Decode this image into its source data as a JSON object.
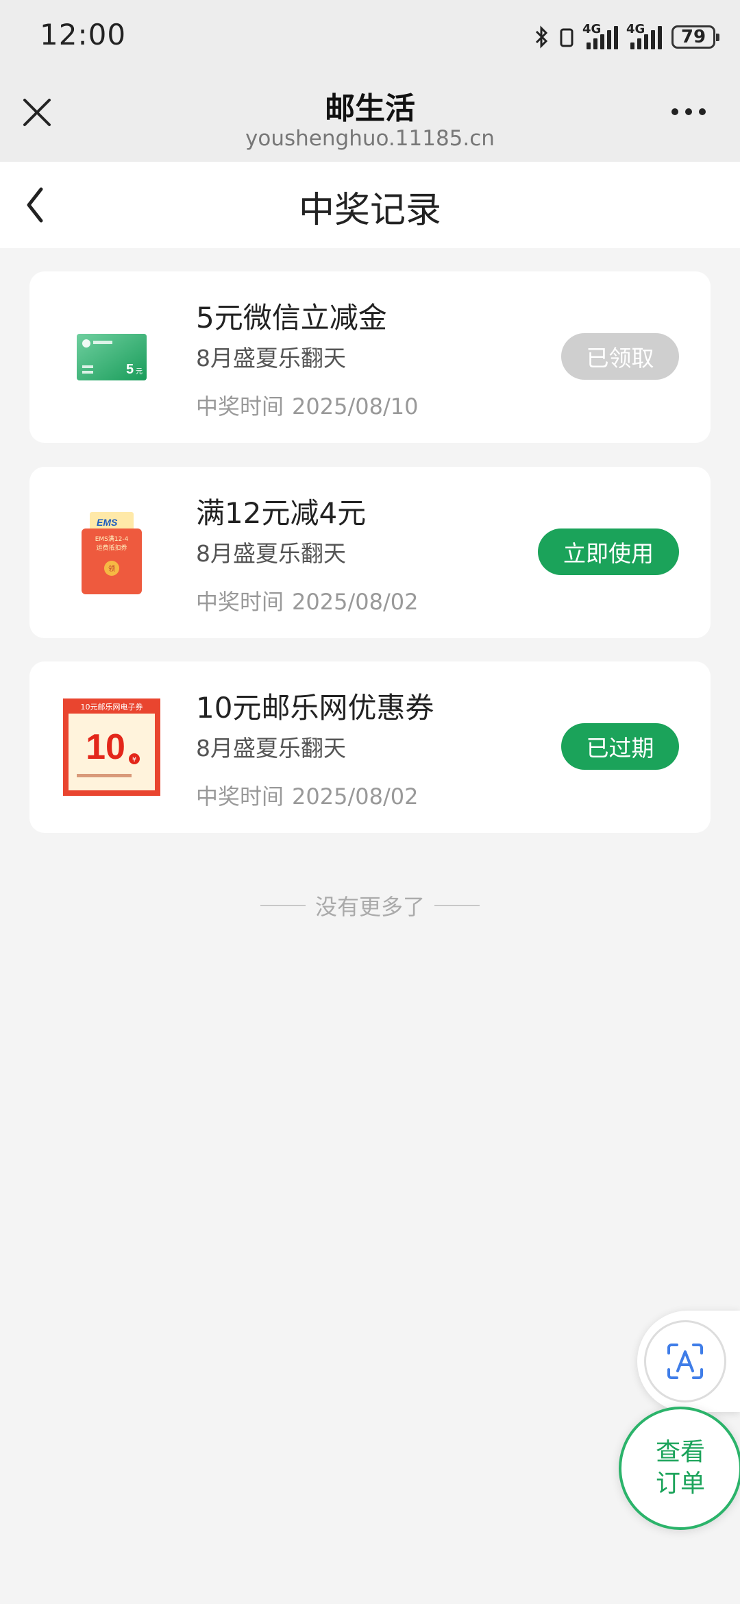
{
  "status_bar": {
    "time": "12:00",
    "battery": "79",
    "network_1": "4G",
    "network_2": "4G"
  },
  "web_header": {
    "title": "邮生活",
    "url": "youshenghuo.11185.cn"
  },
  "nav": {
    "title": "中奖记录"
  },
  "records": [
    {
      "name": "5元微信立减金",
      "activity": "8月盛夏乐翻天",
      "time_label": "中奖时间",
      "time": "2025/08/10",
      "action": "已领取",
      "thumb": {
        "value": "5",
        "unit": "元"
      }
    },
    {
      "name": "满12元减4元",
      "activity": "8月盛夏乐翻天",
      "time_label": "中奖时间",
      "time": "2025/08/02",
      "action": "立即使用",
      "thumb": {
        "brand": "EMS",
        "line1": "EMS满12-4",
        "line2": "运费抵扣券",
        "seal": "领"
      }
    },
    {
      "name": "10元邮乐网优惠券",
      "activity": "8月盛夏乐翻天",
      "time_label": "中奖时间",
      "time": "2025/08/02",
      "action": "已过期",
      "thumb": {
        "header": "10元邮乐网电子券",
        "value": "10",
        "unit": "¥"
      }
    }
  ],
  "end_note": "没有更多了",
  "float": {
    "order_line1": "查看",
    "order_line2": "订单"
  },
  "colors": {
    "accent_green": "#1ba35a",
    "disabled_gray": "#cfcfcf",
    "background": "#f4f4f4"
  }
}
